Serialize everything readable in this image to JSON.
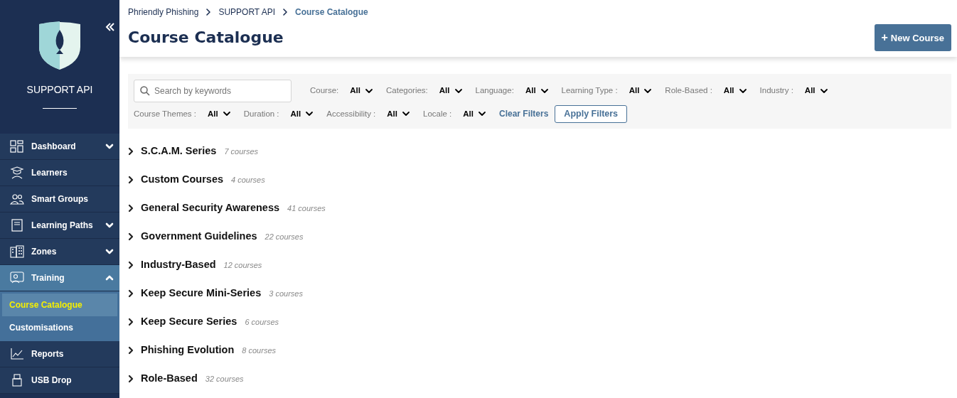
{
  "sidebar": {
    "org_name": "SUPPORT API",
    "items": [
      {
        "label": "Dashboard",
        "kind": "group",
        "expanded": false
      },
      {
        "label": "Learners",
        "kind": "link"
      },
      {
        "label": "Smart Groups",
        "kind": "link"
      },
      {
        "label": "Learning Paths",
        "kind": "group",
        "expanded": false
      },
      {
        "label": "Zones",
        "kind": "group",
        "expanded": false
      },
      {
        "label": "Training",
        "kind": "group",
        "expanded": true,
        "children": [
          {
            "label": "Course Catalogue",
            "selected": true
          },
          {
            "label": "Customisations",
            "selected": false
          }
        ]
      },
      {
        "label": "Reports",
        "kind": "link"
      },
      {
        "label": "USB Drop",
        "kind": "link"
      }
    ]
  },
  "breadcrumb": [
    "Phriendly Phishing",
    "SUPPORT API",
    "Course Catalogue"
  ],
  "page_title": "Course Catalogue",
  "new_button": {
    "icon": "+",
    "label": "New Course"
  },
  "filters": {
    "search": {
      "placeholder": "Search by keywords"
    },
    "dropdowns": [
      {
        "label": "Course:",
        "value": "All"
      },
      {
        "label": "Categories:",
        "value": "All"
      },
      {
        "label": "Language:",
        "value": "All"
      },
      {
        "label": "Learning Type :",
        "value": "All"
      },
      {
        "label": "Role-Based :",
        "value": "All"
      },
      {
        "label": "Industry :",
        "value": "All"
      },
      {
        "label": "Course Themes :",
        "value": "All"
      },
      {
        "label": "Duration :",
        "value": "All"
      },
      {
        "label": "Accessibility :",
        "value": "All"
      },
      {
        "label": "Locale :",
        "value": "All"
      }
    ],
    "clear": "Clear Filters",
    "apply": "Apply Filters"
  },
  "categories": [
    {
      "name": "S.C.A.M. Series",
      "count": "7 courses"
    },
    {
      "name": "Custom Courses",
      "count": "4 courses"
    },
    {
      "name": "General Security Awareness",
      "count": "41 courses"
    },
    {
      "name": "Government Guidelines",
      "count": "22 courses"
    },
    {
      "name": "Industry-Based",
      "count": "12 courses"
    },
    {
      "name": "Keep Secure Mini-Series",
      "count": "3 courses"
    },
    {
      "name": "Keep Secure Series",
      "count": "6 courses"
    },
    {
      "name": "Phishing Evolution",
      "count": "8 courses"
    },
    {
      "name": "Role-Based",
      "count": "32 courses"
    }
  ]
}
